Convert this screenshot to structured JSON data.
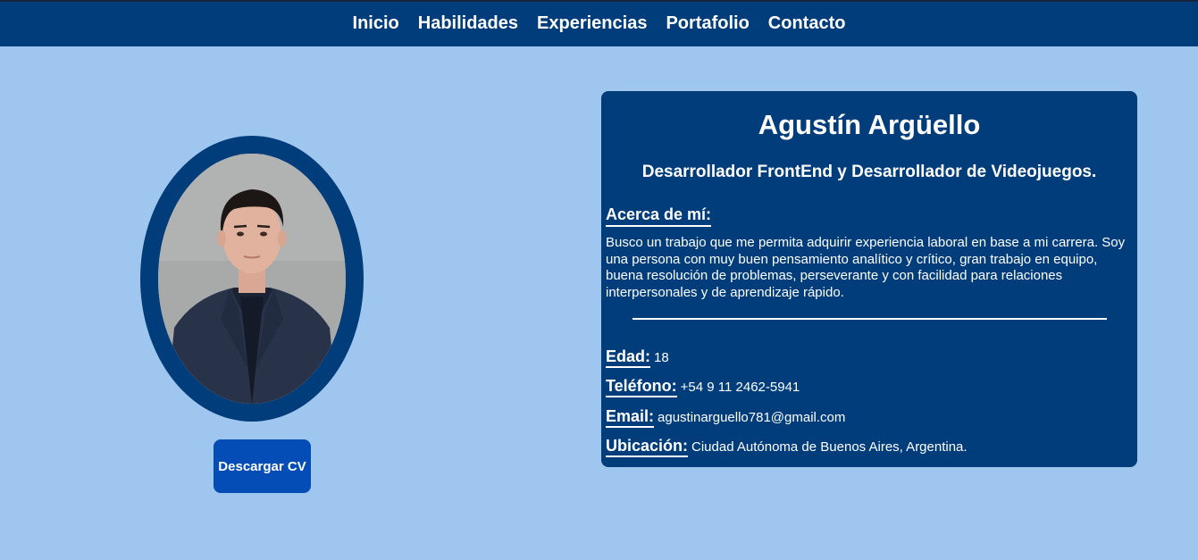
{
  "nav": {
    "items": [
      {
        "label": "Inicio"
      },
      {
        "label": "Habilidades"
      },
      {
        "label": "Experiencias"
      },
      {
        "label": "Portafolio"
      },
      {
        "label": "Contacto"
      }
    ]
  },
  "profile": {
    "download_button": "Descargar CV"
  },
  "card": {
    "name": "Agustín Argüello",
    "subtitle": "Desarrollador FrontEnd y Desarrollador de Videojuegos.",
    "about_heading": "Acerca de mí:",
    "about_text": "Busco un trabajo que me permita adquirir experiencia laboral en base a mi carrera. Soy una persona con muy buen pensamiento analítico y crítico, gran trabajo en equipo, buena resolución de problemas, perseverante y con facilidad para relaciones interpersonales y de aprendizaje rápido.",
    "fields": [
      {
        "label": "Edad:",
        "value": "18"
      },
      {
        "label": "Teléfono:",
        "value": "+54 9 11 2462-5941"
      },
      {
        "label": "Email:",
        "value": "agustinarguello781@gmail.com"
      },
      {
        "label": "Ubicación:",
        "value": "Ciudad Autónoma de Buenos Aires, Argentina."
      }
    ]
  },
  "colors": {
    "background": "#9fc6ee",
    "navbar": "#013d7a",
    "card": "#013d7a",
    "button": "#044cb6",
    "text": "#ffffff"
  }
}
